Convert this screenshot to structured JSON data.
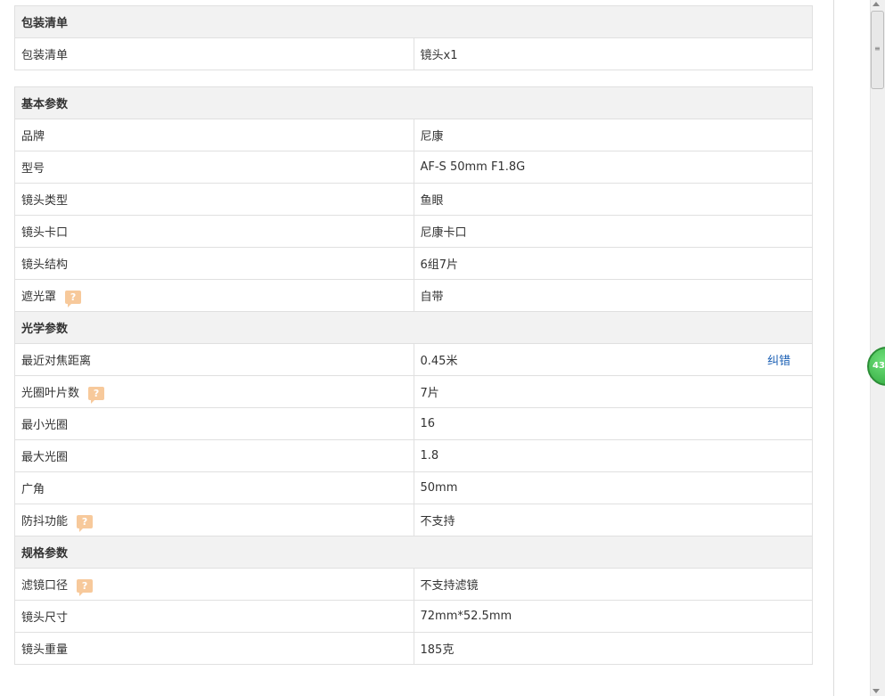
{
  "sections": [
    {
      "title": "包装清单",
      "rows": [
        {
          "label": "包装清单",
          "value": "镜头x1"
        }
      ]
    },
    {
      "title": "基本参数",
      "rows": [
        {
          "label": "品牌",
          "value": "尼康"
        },
        {
          "label": "型号",
          "value": "AF-S 50mm F1.8G"
        },
        {
          "label": "镜头类型",
          "value": "鱼眼"
        },
        {
          "label": "镜头卡口",
          "value": "尼康卡口"
        },
        {
          "label": "镜头结构",
          "value": "6组7片"
        },
        {
          "label": "遮光罩",
          "value": "自带"
        }
      ],
      "sub_title": "光学参数",
      "sub_rows": [
        {
          "label": "最近对焦距离",
          "value": "0.45米"
        },
        {
          "label": "光圈叶片数",
          "value": "7片"
        },
        {
          "label": "最小光圈",
          "value": "16"
        },
        {
          "label": "最大光圈",
          "value": "1.8"
        },
        {
          "label": "广角",
          "value": "50mm"
        },
        {
          "label": "防抖功能",
          "value": "不支持"
        }
      ],
      "sub2_title": "规格参数",
      "sub2_rows": [
        {
          "label": "滤镜口径",
          "value": "不支持滤镜"
        },
        {
          "label": "镜头尺寸",
          "value": "72mm*52.5mm"
        },
        {
          "label": "镜头重量",
          "value": "185克"
        }
      ]
    }
  ],
  "help_glyph": "?",
  "correct_link": "纠错",
  "float_badge": "43",
  "scroll_grip": "≡",
  "icons": [
    "help-icon",
    "scroll-up-icon",
    "scroll-down-icon"
  ],
  "colors": {
    "header_bg": "#f2f2f2",
    "border": "#e0e0e0",
    "help": "#f7c99b",
    "link": "#1a5fb4",
    "badge": "#2da53b"
  }
}
